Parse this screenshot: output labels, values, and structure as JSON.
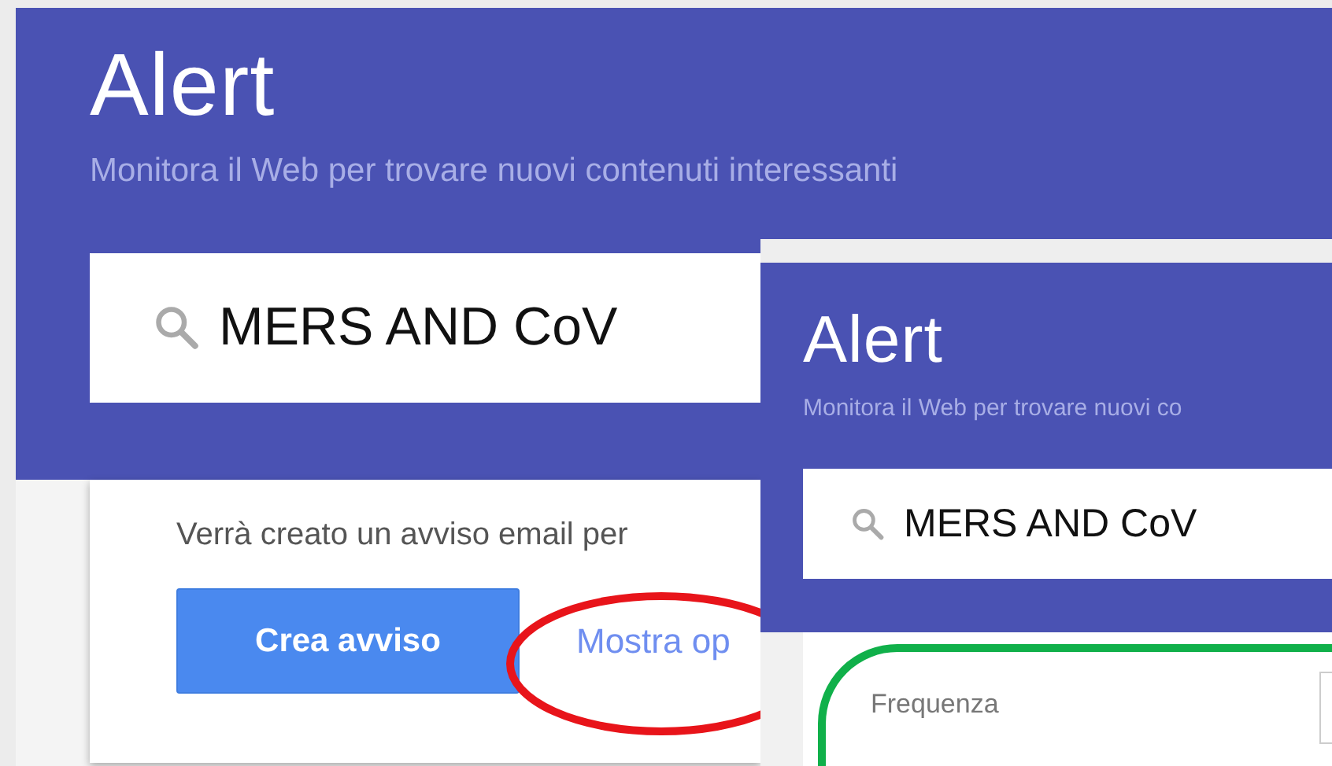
{
  "back_window": {
    "title": "Alert",
    "subtitle": "Monitora il Web per trovare nuovi contenuti interessanti",
    "search": {
      "value": "MERS AND CoV"
    },
    "notice": "Verrà creato un avviso email per",
    "create_button": "Crea avviso",
    "options_link": "Mostra op"
  },
  "front_window": {
    "title": "Alert",
    "subtitle": "Monitora il Web per trovare nuovi co",
    "search": {
      "value": "MERS AND CoV"
    },
    "frequency_label": "Frequenza"
  }
}
